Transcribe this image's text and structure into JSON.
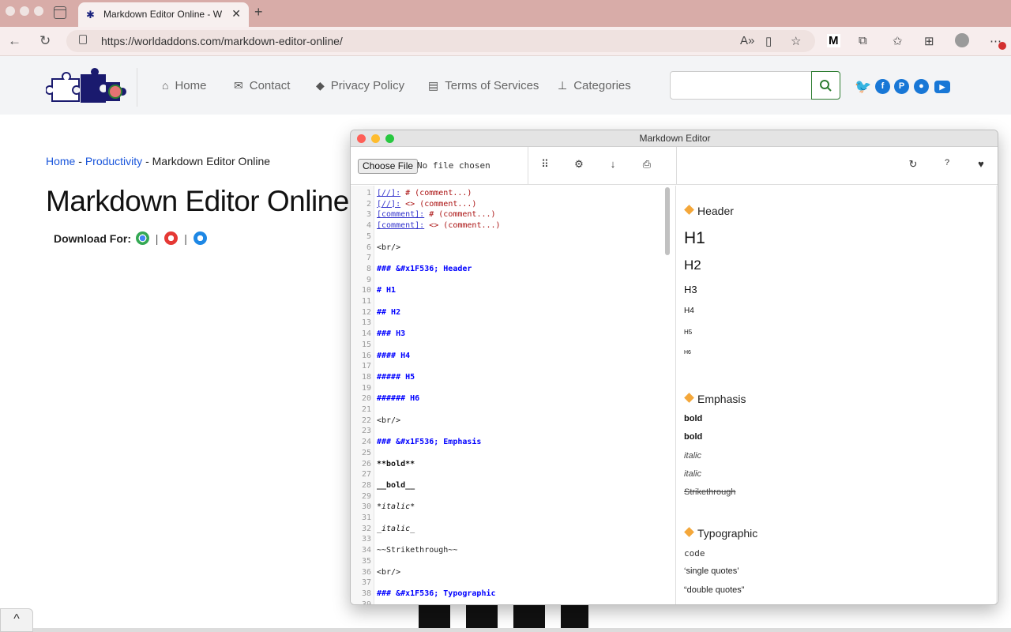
{
  "browser": {
    "tab_title": "Markdown Editor Online - Worl",
    "tab_close": "✕",
    "new_tab": "+",
    "url": "https://worldaddons.com/markdown-editor-online/",
    "icons": [
      "back-icon",
      "reload-icon",
      "read-aloud-icon",
      "immersive-reader-icon",
      "add-favorite-icon",
      "extension-m-icon",
      "extensions-icon",
      "favorites-icon",
      "collections-icon",
      "profile-icon",
      "more-icon"
    ],
    "toolbar_m_label": "M"
  },
  "site": {
    "nav": [
      {
        "label": "Home",
        "icon": "home-icon"
      },
      {
        "label": "Contact",
        "icon": "envelope-icon"
      },
      {
        "label": "Privacy Policy",
        "icon": "graduation-cap-icon"
      },
      {
        "label": "Terms of Services",
        "icon": "document-icon"
      },
      {
        "label": "Categories",
        "icon": "sitemap-icon"
      }
    ],
    "search_placeholder": "",
    "social": [
      "twitter-icon",
      "facebook-icon",
      "pinterest-icon",
      "reddit-icon",
      "youtube-icon"
    ],
    "colors": {
      "link": "#1a56db",
      "social": "#1877d6",
      "search_border": "#2e7d32"
    }
  },
  "page": {
    "breadcrumb": {
      "home": "Home",
      "sep": "-",
      "category": "Productivity",
      "current": "Markdown Editor Online"
    },
    "title": "Markdown Editor Online",
    "download_label": "Download For:",
    "download_sep": "|",
    "browsers": [
      "chrome-icon",
      "firefox-icon",
      "edge-icon"
    ],
    "back_to_top": "^"
  },
  "editor_window": {
    "title": "Markdown Editor",
    "choose_file": "Choose File",
    "no_file": "No file chosen",
    "tools": [
      "apps-grid-icon",
      "settings-gear-icon",
      "download-arrow-icon",
      "print-icon"
    ],
    "right_tools": [
      "refresh-icon",
      "help-icon",
      "heart-icon"
    ],
    "help_label": "?",
    "source_lines": [
      {
        "n": "1",
        "segs": [
          {
            "t": "[//]:",
            "c": "c-link"
          },
          {
            "t": " # (comment...)",
            "c": "c-cmt"
          }
        ]
      },
      {
        "n": "2",
        "segs": [
          {
            "t": "[//]:",
            "c": "c-link"
          },
          {
            "t": " <> (comment...)",
            "c": "c-cmt"
          }
        ]
      },
      {
        "n": "3",
        "segs": [
          {
            "t": "[comment]:",
            "c": "c-link"
          },
          {
            "t": " # (comment...)",
            "c": "c-cmt"
          }
        ]
      },
      {
        "n": "4",
        "segs": [
          {
            "t": "[comment]:",
            "c": "c-link"
          },
          {
            "t": " <> (comment...)",
            "c": "c-cmt"
          }
        ]
      },
      {
        "n": "5",
        "segs": []
      },
      {
        "n": "6",
        "segs": [
          {
            "t": "<br/>",
            "c": ""
          }
        ]
      },
      {
        "n": "7",
        "segs": []
      },
      {
        "n": "8",
        "segs": [
          {
            "t": "### &#x1F536; Header",
            "c": "c-hdr"
          }
        ]
      },
      {
        "n": "9",
        "segs": []
      },
      {
        "n": "10",
        "segs": [
          {
            "t": "# H1",
            "c": "c-hdr"
          }
        ]
      },
      {
        "n": "11",
        "segs": []
      },
      {
        "n": "12",
        "segs": [
          {
            "t": "## H2",
            "c": "c-hdr"
          }
        ]
      },
      {
        "n": "13",
        "segs": []
      },
      {
        "n": "14",
        "segs": [
          {
            "t": "### H3",
            "c": "c-hdr"
          }
        ]
      },
      {
        "n": "15",
        "segs": []
      },
      {
        "n": "16",
        "segs": [
          {
            "t": "#### H4",
            "c": "c-hdr"
          }
        ]
      },
      {
        "n": "17",
        "segs": []
      },
      {
        "n": "18",
        "segs": [
          {
            "t": "##### H5",
            "c": "c-hdr"
          }
        ]
      },
      {
        "n": "19",
        "segs": []
      },
      {
        "n": "20",
        "segs": [
          {
            "t": "###### H6",
            "c": "c-hdr"
          }
        ]
      },
      {
        "n": "21",
        "segs": []
      },
      {
        "n": "22",
        "segs": [
          {
            "t": "<br/>",
            "c": ""
          }
        ]
      },
      {
        "n": "23",
        "segs": []
      },
      {
        "n": "24",
        "segs": [
          {
            "t": "### &#x1F536; Emphasis",
            "c": "c-hdr"
          }
        ]
      },
      {
        "n": "25",
        "segs": []
      },
      {
        "n": "26",
        "segs": [
          {
            "t": "**bold**",
            "c": "c-bold"
          }
        ]
      },
      {
        "n": "27",
        "segs": []
      },
      {
        "n": "28",
        "segs": [
          {
            "t": "__bold__",
            "c": "c-bold"
          }
        ]
      },
      {
        "n": "29",
        "segs": []
      },
      {
        "n": "30",
        "segs": [
          {
            "t": "*italic*",
            "c": "c-it"
          }
        ]
      },
      {
        "n": "31",
        "segs": []
      },
      {
        "n": "32",
        "segs": [
          {
            "t": "_italic_",
            "c": "c-it"
          }
        ]
      },
      {
        "n": "33",
        "segs": []
      },
      {
        "n": "34",
        "segs": [
          {
            "t": "~~Strikethrough~~",
            "c": ""
          }
        ]
      },
      {
        "n": "35",
        "segs": []
      },
      {
        "n": "36",
        "segs": [
          {
            "t": "<br/>",
            "c": ""
          }
        ]
      },
      {
        "n": "37",
        "segs": []
      },
      {
        "n": "38",
        "segs": [
          {
            "t": "### &#x1F536; Typographic",
            "c": "c-hdr"
          }
        ]
      },
      {
        "n": "39",
        "segs": []
      }
    ],
    "preview": [
      {
        "text": "Header",
        "style": "section"
      },
      {
        "text": "H1",
        "style": "h1"
      },
      {
        "text": "H2",
        "style": "h2"
      },
      {
        "text": "H3",
        "style": "h3"
      },
      {
        "text": "H4",
        "style": "h4"
      },
      {
        "text": "H5",
        "style": "h5"
      },
      {
        "text": "H6",
        "style": "h6"
      },
      {
        "text": "Emphasis",
        "style": "section"
      },
      {
        "text": "bold",
        "style": "bold"
      },
      {
        "text": "bold",
        "style": "bold"
      },
      {
        "text": "italic",
        "style": "italic"
      },
      {
        "text": "italic",
        "style": "italic"
      },
      {
        "text": "Strikethrough",
        "style": "strike"
      },
      {
        "text": "Typographic",
        "style": "section"
      },
      {
        "text": "code",
        "style": "code"
      },
      {
        "text": "‘single quotes’",
        "style": "body"
      },
      {
        "text": "“double quotes”",
        "style": "body"
      }
    ]
  }
}
